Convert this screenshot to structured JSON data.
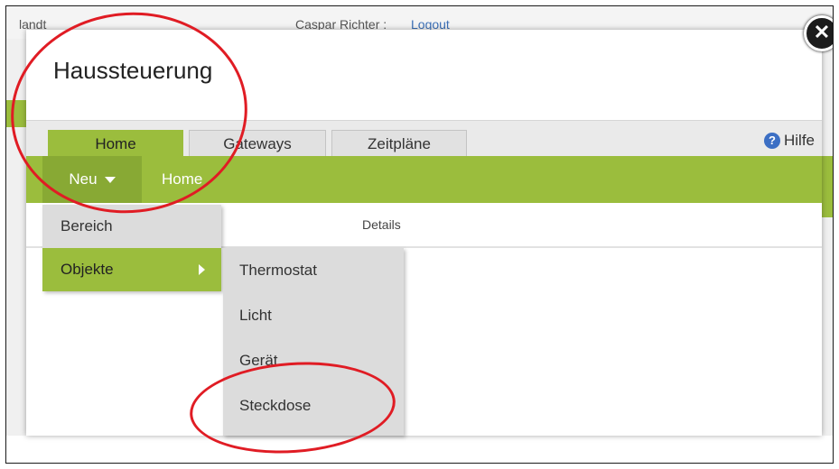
{
  "background": {
    "left_text": "landt",
    "user_text": "Caspar Richter :",
    "logout_text": "Logout"
  },
  "dialog": {
    "title": "Haussteuerung",
    "close_glyph": "✕"
  },
  "tabs": [
    {
      "label": "Home",
      "active": true
    },
    {
      "label": "Gateways",
      "active": false
    },
    {
      "label": "Zeitpläne",
      "active": false
    }
  ],
  "help": {
    "label": "Hilfe",
    "icon": "help-icon"
  },
  "toolbar": {
    "new_label": "Neu",
    "breadcrumb": "Home"
  },
  "details_label": "Details",
  "menu": {
    "items": [
      {
        "label": "Bereich"
      },
      {
        "label": "Objekte",
        "highlighted": true
      }
    ]
  },
  "submenu": {
    "items": [
      {
        "label": "Thermostat"
      },
      {
        "label": "Licht"
      },
      {
        "label": "Gerät"
      },
      {
        "label": "Steckdose"
      }
    ]
  },
  "colors": {
    "accent_green": "#9bbd3d",
    "annotation_red": "#e01c24"
  }
}
